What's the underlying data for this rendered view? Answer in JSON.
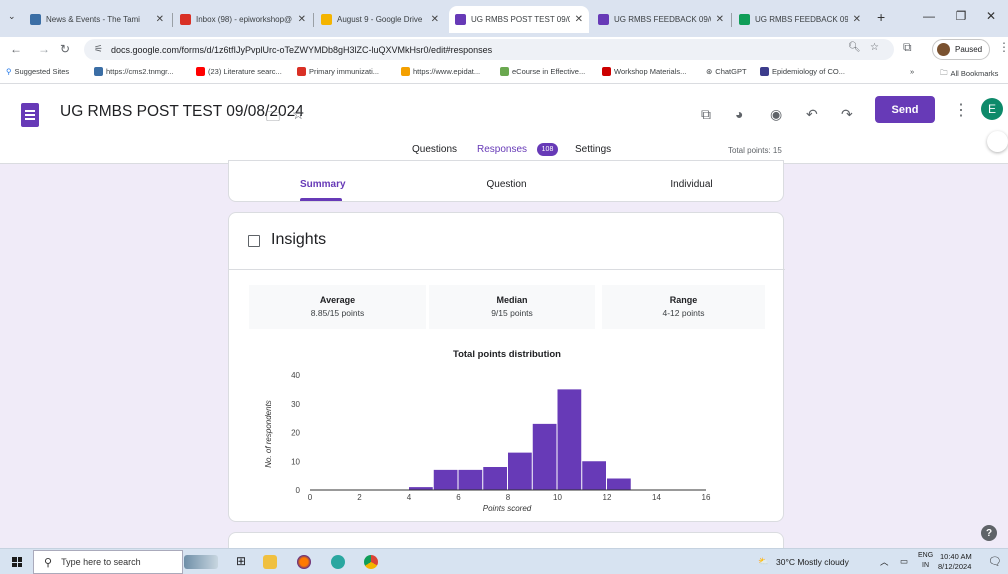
{
  "browser": {
    "tabs": [
      {
        "title": "News & Events - The Tami",
        "color": "#3b6ea5"
      },
      {
        "title": "Inbox (98) - epiworkshop@",
        "color": "#d93025"
      },
      {
        "title": "August 9 - Google Drive",
        "color": "#f4b400"
      },
      {
        "title": "UG RMBS POST TEST 09/0",
        "color": "#673ab7"
      },
      {
        "title": "UG RMBS FEEDBACK 09/0",
        "color": "#673ab7"
      },
      {
        "title": "UG RMBS FEEDBACK 09/0",
        "color": "#0f9d58"
      }
    ],
    "new_tab": "+",
    "url": "docs.google.com/forms/d/1z6tfIJyPvplUrc-oTeZWYMDb8gH3lZC-luQXVMkHsr0/edit#responses",
    "profile_status": "Paused",
    "bookmarks": [
      "Suggested Sites",
      "https://cms2.tnmgr...",
      "(23) Literature searc...",
      "Primary immunizati...",
      "https://www.epidat...",
      "eCourse in Effective...",
      "Workshop Materials...",
      "ChatGPT",
      "Epidemiology of CO..."
    ],
    "bookmarks_overflow": "»",
    "all_bookmarks": "All Bookmarks"
  },
  "form": {
    "title": "UG RMBS POST TEST 09/08/2024",
    "send_label": "Send",
    "avatar_initial": "E",
    "tabs": {
      "questions": "Questions",
      "responses": "Responses",
      "settings": "Settings"
    },
    "response_count": "108",
    "total_points": "Total points: 15",
    "subtabs": {
      "summary": "Summary",
      "question": "Question",
      "individual": "Individual"
    },
    "insights_title": "Insights",
    "stats": [
      {
        "label": "Average",
        "value": "8.85/15 points"
      },
      {
        "label": "Median",
        "value": "9/15 points"
      },
      {
        "label": "Range",
        "value": "4-12 points"
      }
    ],
    "help": "?"
  },
  "chart_data": {
    "type": "bar",
    "title": "Total points distribution",
    "xlabel": "Points scored",
    "ylabel": "No. of respondents",
    "x": [
      4,
      5,
      6,
      7,
      8,
      9,
      10,
      11,
      12
    ],
    "values": [
      1,
      7,
      7,
      8,
      13,
      23,
      35,
      10,
      4
    ],
    "xlim": [
      0,
      16
    ],
    "ylim": [
      0,
      40
    ],
    "xticks": [
      0,
      2,
      4,
      6,
      8,
      10,
      12,
      14,
      16
    ],
    "yticks": [
      0,
      10,
      20,
      30,
      40
    ],
    "color": "#673ab7",
    "grid": false
  },
  "taskbar": {
    "search_placeholder": "Type here to search",
    "weather": "30°C  Mostly cloudy",
    "lang1": "ENG",
    "lang2": "IN",
    "time": "10:40 AM",
    "date": "8/12/2024"
  }
}
